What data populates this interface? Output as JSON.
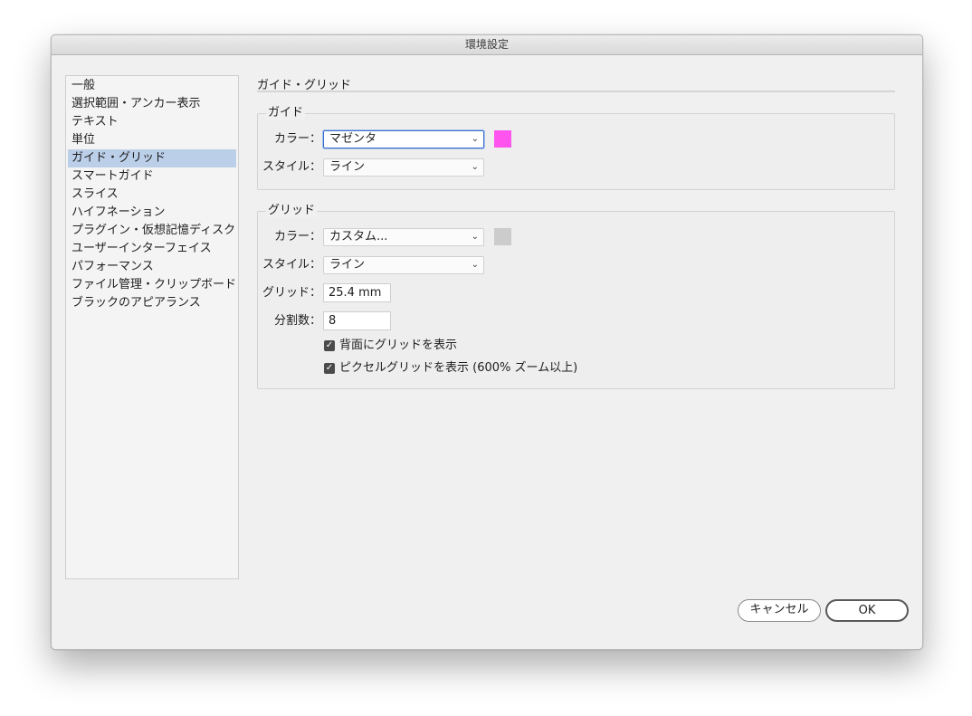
{
  "window": {
    "title": "環境設定"
  },
  "sidebar": {
    "items": [
      {
        "label": "一般"
      },
      {
        "label": "選択範囲・アンカー表示"
      },
      {
        "label": "テキスト"
      },
      {
        "label": "単位"
      },
      {
        "label": "ガイド・グリッド",
        "selected": true
      },
      {
        "label": "スマートガイド"
      },
      {
        "label": "スライス"
      },
      {
        "label": "ハイフネーション"
      },
      {
        "label": "プラグイン・仮想記憶ディスク"
      },
      {
        "label": "ユーザーインターフェイス"
      },
      {
        "label": "パフォーマンス"
      },
      {
        "label": "ファイル管理・クリップボード"
      },
      {
        "label": "ブラックのアピアランス"
      }
    ]
  },
  "panel": {
    "title": "ガイド・グリッド",
    "guide": {
      "legend": "ガイド",
      "color_label": "カラー：",
      "color_value": "マゼンタ",
      "color_swatch": "#ff55ee",
      "style_label": "スタイル：",
      "style_value": "ライン"
    },
    "grid": {
      "legend": "グリッド",
      "color_label": "カラー：",
      "color_value": "カスタム...",
      "color_swatch": "#cccccc",
      "style_label": "スタイル：",
      "style_value": "ライン",
      "gridline_label": "グリッド：",
      "gridline_value": "25.4 mm",
      "subdivisions_label": "分割数：",
      "subdivisions_value": "8",
      "grids_in_back_label": "背面にグリッドを表示",
      "grids_in_back_checked": true,
      "pixel_grid_label": "ピクセルグリッドを表示 (600% ズーム以上)",
      "pixel_grid_checked": true
    }
  },
  "buttons": {
    "cancel": "キャンセル",
    "ok": "OK"
  }
}
